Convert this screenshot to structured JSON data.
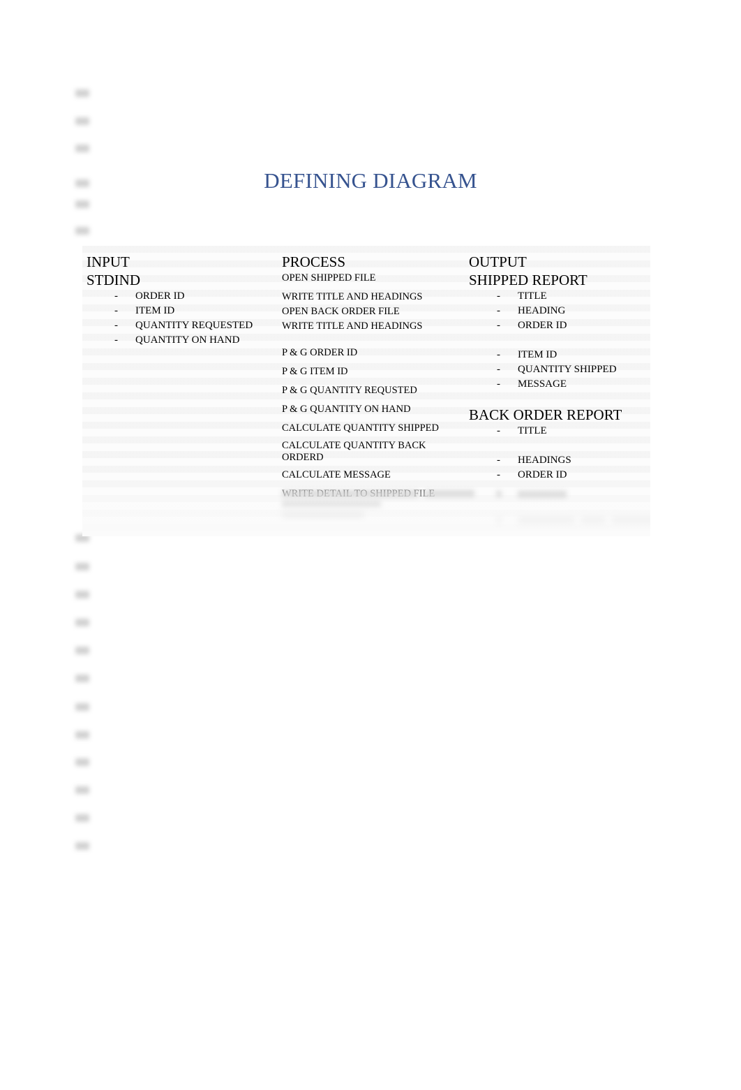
{
  "document": {
    "title": "DEFINING DIAGRAM",
    "title_color": "#36538F",
    "page_background": "#ffffff",
    "table_background": "#fbfbfb"
  },
  "table": {
    "columns": [
      {
        "header": "INPUT",
        "subheader": "STDIND",
        "items": [
          "ORDER ID",
          "ITEM ID",
          "QUANTITY REQUESTED",
          "QUANTITY ON HAND"
        ]
      },
      {
        "header": "PROCESS",
        "lines": [
          "OPEN SHIPPED FILE",
          "WRITE TITLE AND HEADINGS",
          "OPEN BACK ORDER FILE",
          "WRITE TITLE AND HEADINGS",
          "P & G ORDER ID",
          "P & G ITEM ID",
          "P & G QUANTITY REQUSTED",
          "P & G QUANTITY ON HAND",
          "CALCULATE QUANTITY SHIPPED",
          "CALCULATE QUANTITY BACK ORDERD",
          "CALCULATE MESSAGE",
          "WRITE DETAIL TO SHIPPED FILE"
        ]
      },
      {
        "header": "OUTPUT",
        "report_one_title": "SHIPPED REPORT",
        "report_one_items": [
          "TITLE",
          "HEADING",
          "ORDER ID",
          "ITEM ID",
          "QUANTITY SHIPPED",
          "MESSAGE"
        ],
        "report_two_title": "BACK ORDER REPORT",
        "report_two_items": [
          "TITLE",
          "HEADINGS",
          "ORDER ID"
        ]
      }
    ],
    "bullet_dash": "-"
  }
}
